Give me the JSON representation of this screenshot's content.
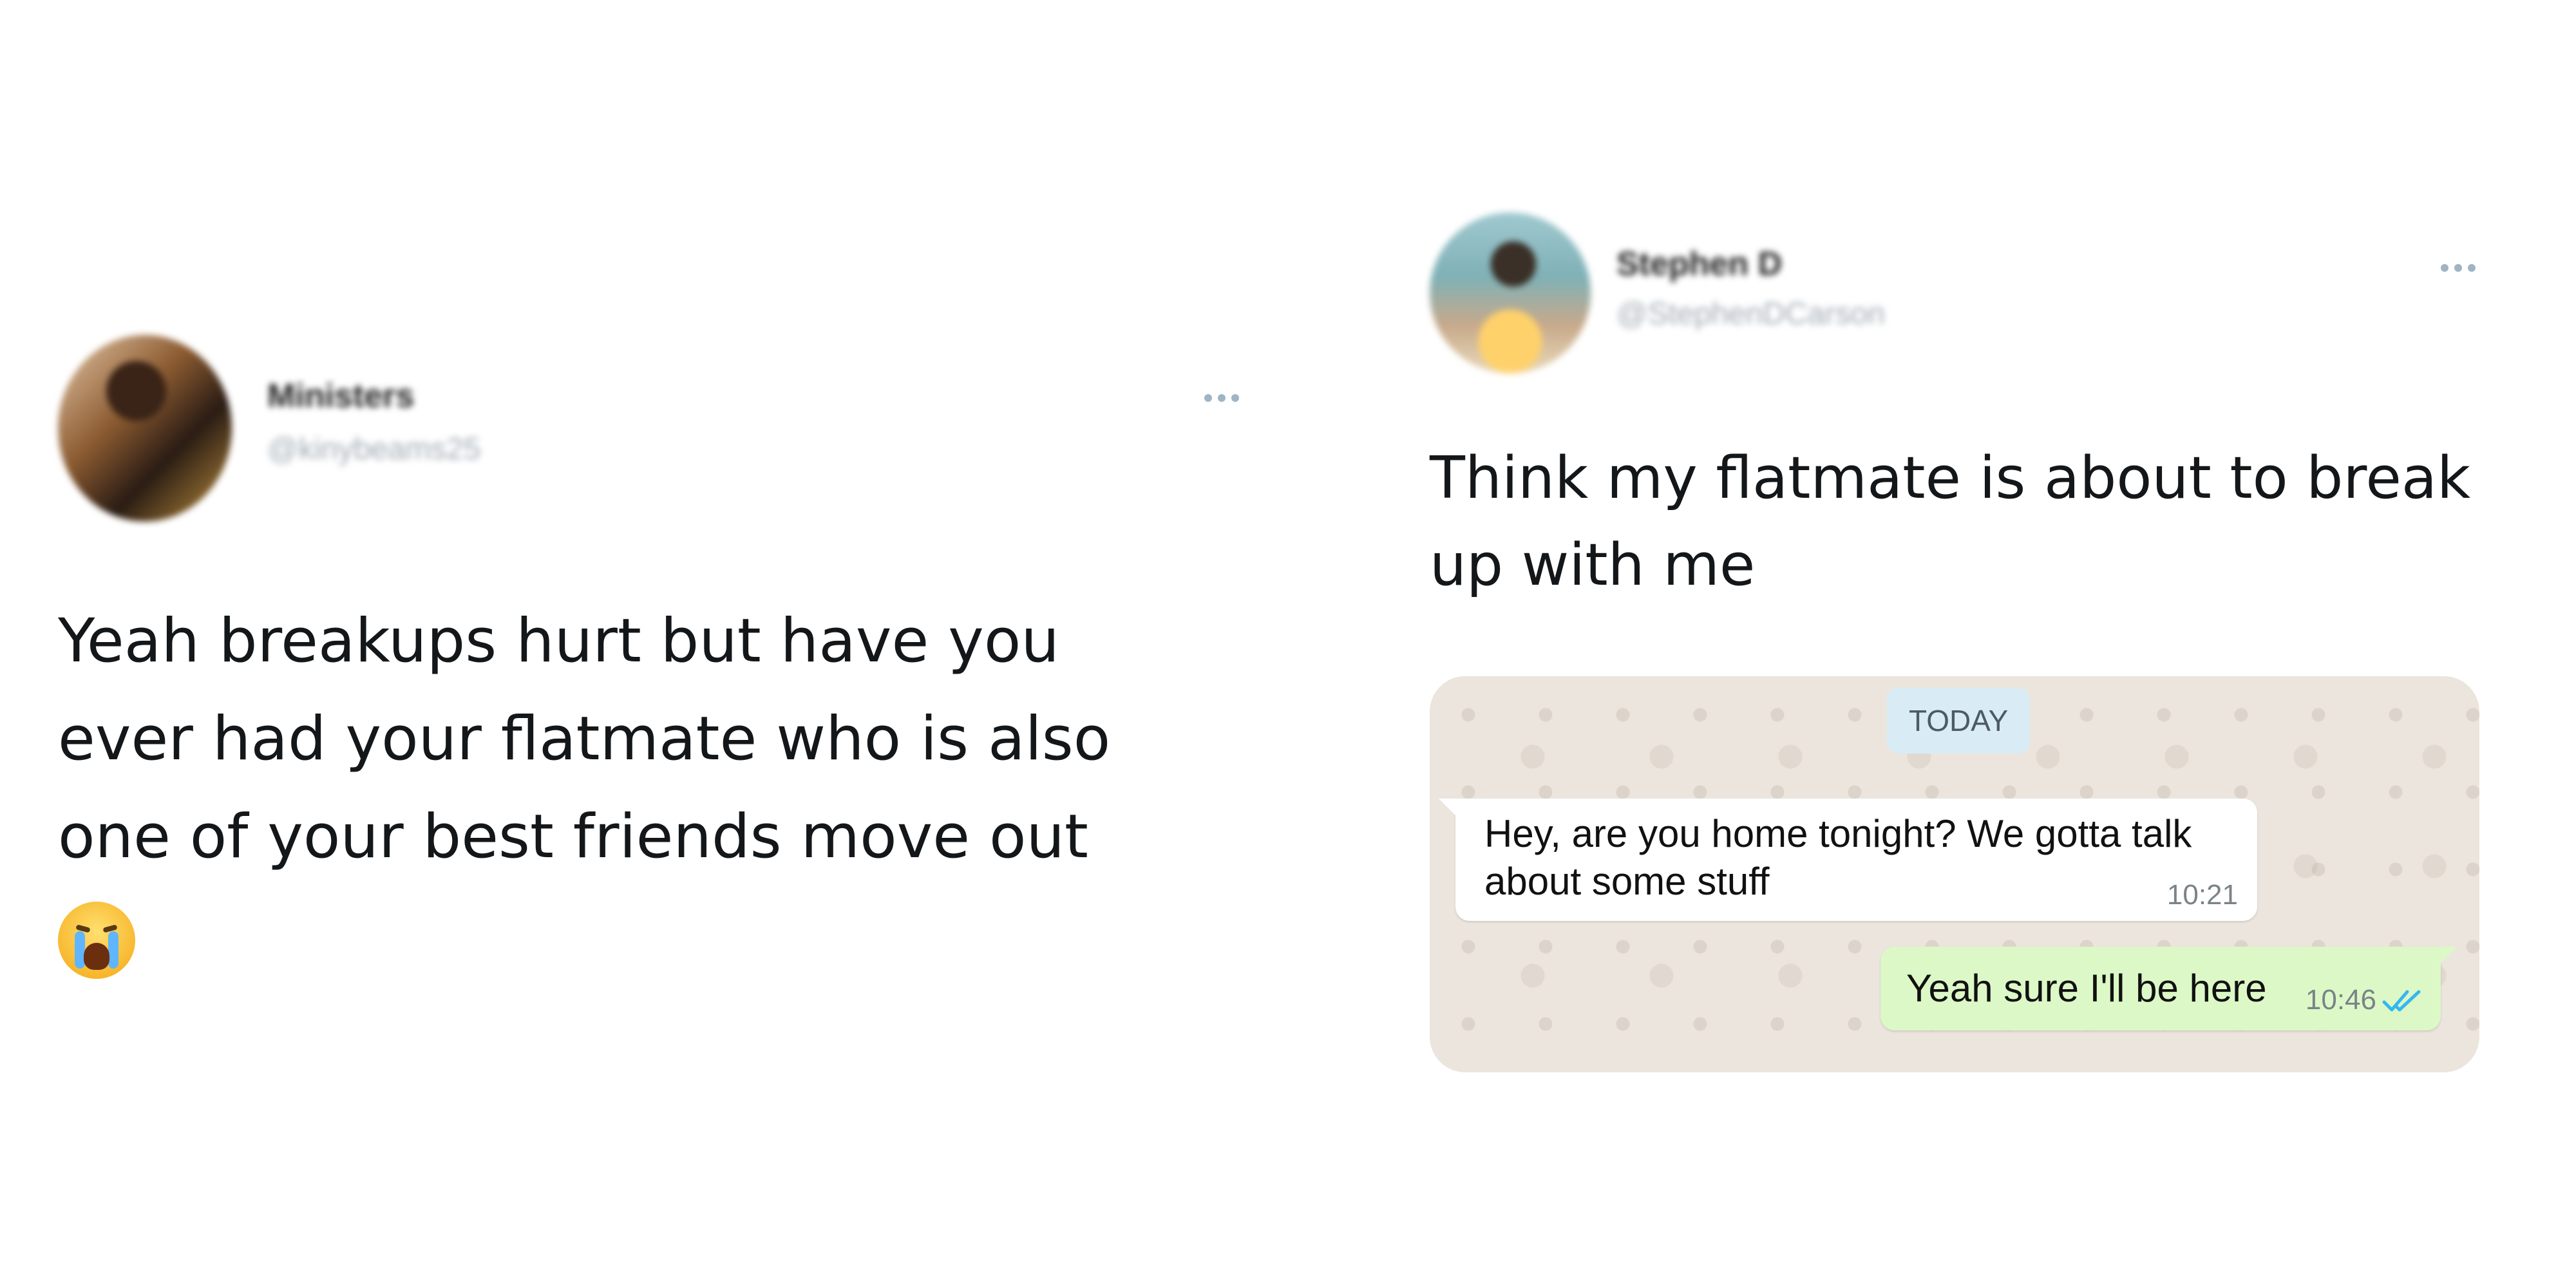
{
  "left_tweet": {
    "display_name": "Ministers",
    "handle": "@kinybeams25",
    "text": "Yeah breakups hurt but have you\never had your flatmate who is also\none of your best friends move out",
    "emoji": "loudly-crying-face"
  },
  "right_tweet": {
    "display_name": "Stephen D",
    "handle": "@StephenDCarson",
    "text": "Think my flatmate is about to break\nup with me",
    "chat": {
      "date_label": "TODAY",
      "messages": [
        {
          "direction": "incoming",
          "text": "Hey, are you home tonight? We gotta talk\nabout some stuff",
          "time": "10:21"
        },
        {
          "direction": "outgoing",
          "text": "Yeah sure I'll be here",
          "time": "10:46",
          "status": "read"
        }
      ],
      "colors": {
        "background": "#ece5dd",
        "incoming": "#ffffff",
        "outgoing": "#dcf8c6",
        "ticks": "#34b7f1"
      }
    }
  }
}
